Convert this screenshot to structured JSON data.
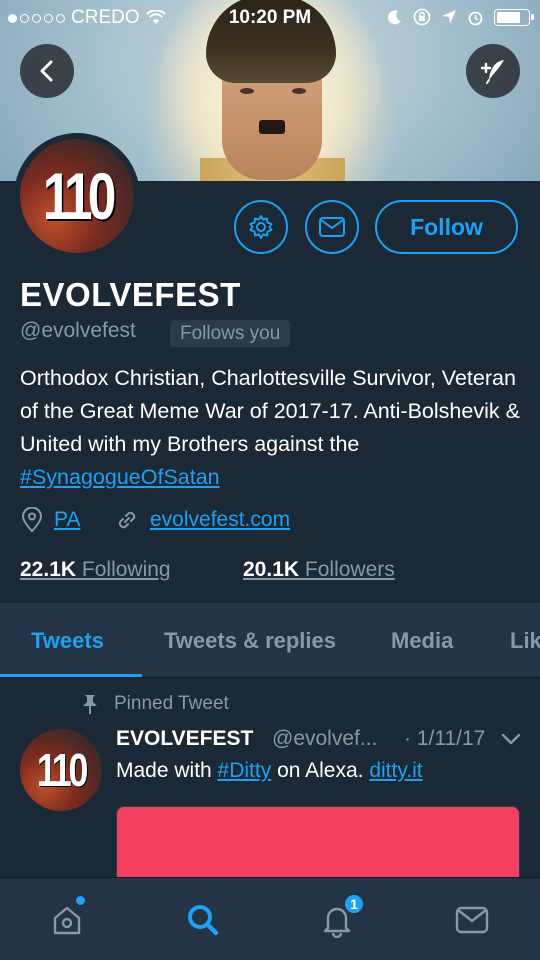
{
  "status_bar": {
    "carrier": "CREDO",
    "time": "10:20 PM",
    "signal_bars_filled": 1,
    "battery_level": 0.75
  },
  "header": {
    "back_icon": "chevron-left-icon",
    "compose_icon": "compose-tweet-icon"
  },
  "profile": {
    "avatar_text": "110",
    "display_name": "EVOLVEFEST",
    "handle": "@evolvefest",
    "follows_you_label": "Follows you",
    "follow_label": "Follow",
    "bio_text": "Orthodox Christian, Charlottesville Survivor, Veteran of the Great Meme War of 2017-17. Anti-Bolshevik & United with my Brothers against the ",
    "bio_hashtag": "#SynagogueOfSatan",
    "location": "PA",
    "website": "evolvefest.com",
    "following_count": "22.1K",
    "following_label": "Following",
    "followers_count": "20.1K",
    "followers_label": "Followers"
  },
  "tabs": [
    {
      "label": "Tweets",
      "active": true
    },
    {
      "label": "Tweets & replies",
      "active": false
    },
    {
      "label": "Media",
      "active": false
    },
    {
      "label": "Lik",
      "active": false
    }
  ],
  "tweet": {
    "pinned_label": "Pinned Tweet",
    "author_name": "EVOLVEFEST",
    "author_handle": "@evolvef...",
    "date": "· 1/11/17",
    "text_prefix": "Made with ",
    "hashtag": "#Ditty",
    "text_middle": " on Alexa. ",
    "link": "ditty.it",
    "avatar_text": "110"
  },
  "bottom_nav": {
    "items": [
      "home-icon",
      "search-icon",
      "notifications-icon",
      "messages-icon"
    ],
    "notification_count": "1"
  },
  "colors": {
    "background": "#1b2836",
    "accent": "#1da1f2",
    "secondary_text": "#8899a6",
    "nav_background": "#243447",
    "media_color": "#f44060"
  }
}
